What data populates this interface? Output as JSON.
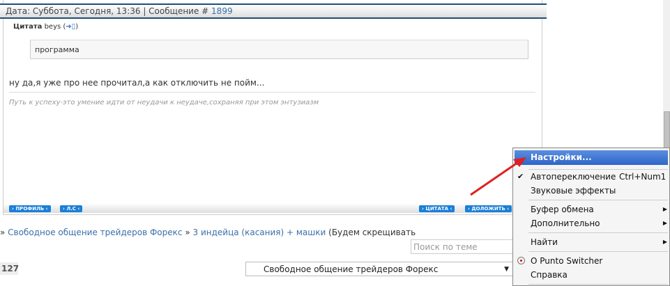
{
  "post": {
    "date_text": "Дата: Суббота, Сегодня, 13:36 | Сообщение # ",
    "msg_number": "1899",
    "quote_label": "Цитата",
    "quote_author": "beys",
    "quote_text": "программа",
    "message": "ну да,я уже про нее прочитал,а как отключить не пойм...",
    "signature": "Путь к успеху-это умение идти от неудачи к неудаче,сохраняя при этом энтузиазм",
    "buttons": {
      "profile": "ПРОФИЛЬ",
      "pm": "Л.С",
      "quote": "ЦИТАТА",
      "report": "ДОЛОЖИТЬ"
    }
  },
  "breadcrumb": {
    "sep": "»",
    "forum": "Свободное общение трейдеров Форекс",
    "topic": "3 индейца (касания) + машки",
    "suffix": "(Будем скрещивать"
  },
  "search": {
    "placeholder": "Поиск по теме"
  },
  "page_count": "127",
  "forum_select": {
    "value": "Свободное общение трейдеров Форекс"
  },
  "context_menu": {
    "items": [
      {
        "label": "Настройки..."
      },
      {
        "label": "Автопереключение",
        "shortcut": "Ctrl+Num1",
        "checked": true
      },
      {
        "label": "Звуковые эффекты"
      },
      {
        "label": "Буфер обмена",
        "submenu": true
      },
      {
        "label": "Дополнительно",
        "submenu": true
      },
      {
        "label": "Найти",
        "submenu": true
      },
      {
        "label": "О Punto Switcher"
      },
      {
        "label": "Справка"
      }
    ]
  },
  "colors": {
    "accent": "#3a6fa8",
    "button": "#1a7fd8",
    "arrow": "#e02020",
    "highlight": "#3a72d0"
  }
}
